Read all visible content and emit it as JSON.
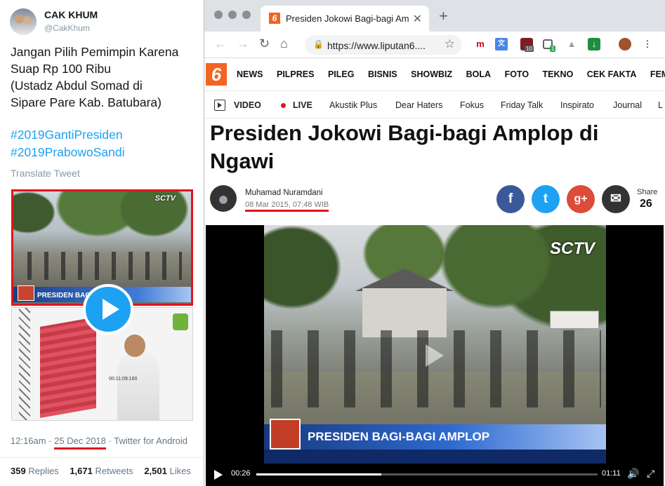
{
  "tweet": {
    "name": "CAK KHUM",
    "handle": "@CakKhum",
    "text_lines": [
      "Jangan Pilih Pemimpin Karena",
      "Suap Rp 100 Ribu",
      "(Ustadz Abdul Somad di",
      "Sipare Pare Kab. Batubara)"
    ],
    "hashtags": [
      "#2019GantiPresiden",
      "#2019PrabowoSandi"
    ],
    "translate": "Translate Tweet",
    "media_top": {
      "channel": "SCTV",
      "banner": "PRESIDEN BAGI-B"
    },
    "media_bottom": {
      "timestamp": "00:11:09:160"
    },
    "time": "12:16am",
    "sep1": " · ",
    "date": "25 Dec 2018",
    "sep2": " · ",
    "client": "Twitter for Android",
    "stats": {
      "replies_count": "359",
      "replies_label": "Replies",
      "retweets_count": "1,671",
      "retweets_label": "Retweets",
      "likes_count": "2,501",
      "likes_label": "Likes"
    }
  },
  "browser": {
    "tab_title": "Presiden Jokowi Bagi-bagi Amplop di Ngawi",
    "tab_close": "✕",
    "new_tab": "+",
    "url": "https://www.liputan6....",
    "extension_badges": [
      "10",
      "1"
    ],
    "extension_letter": "m"
  },
  "site": {
    "logo": "6",
    "nav": [
      "NEWS",
      "PILPRES",
      "PILEG",
      "BISNIS",
      "SHOWBIZ",
      "BOLA",
      "FOTO",
      "TEKNO",
      "CEK FAKTA",
      "FEMALE"
    ],
    "subnav_video": "VIDEO",
    "subnav_live": "LIVE",
    "subnav": [
      "Akustik Plus",
      "Dear Haters",
      "Fokus",
      "Friday Talk",
      "Inspirato",
      "Journal",
      "L"
    ]
  },
  "article": {
    "headline_lines": [
      "Presiden Jokowi Bagi-bagi Amplop di",
      "Ngawi"
    ],
    "author": "Muhamad Nuramdani",
    "date": "08 Mar 2015, 07:48 WIB",
    "share_label": "Share",
    "share_count": "26",
    "share_buttons": {
      "facebook": "f",
      "twitter": "t",
      "googleplus": "g+",
      "email": "✉"
    }
  },
  "video": {
    "channel": "SCTV",
    "banner": "PRESIDEN BAGI-BAGI AMPLOP",
    "current_time": "00:26",
    "duration": "01:11",
    "progress": 0.366
  },
  "colors": {
    "twitter_blue": "#1da1f2",
    "liputan_orange": "#f26522",
    "highlight_red": "#e0141b",
    "facebook": "#3b5998",
    "twitter": "#1da1f2",
    "googleplus": "#dd4b39",
    "email": "#333333"
  }
}
